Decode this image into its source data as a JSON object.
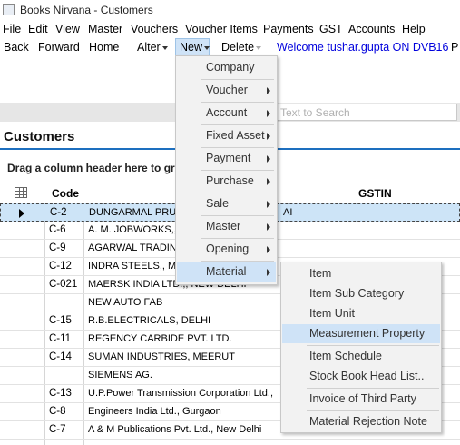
{
  "window": {
    "title": "Books Nirvana - Customers"
  },
  "menubar": [
    "File",
    "Edit",
    "View",
    "Master",
    "Vouchers",
    "Voucher Items",
    "Payments",
    "GST",
    "Accounts",
    "Help"
  ],
  "toolbar": {
    "back": "Back",
    "forward": "Forward",
    "home": "Home",
    "alter": "Alter",
    "new": "New",
    "delete": "Delete",
    "welcome": "Welcome tushar.gupta ON DVB16",
    "overflow": "P"
  },
  "search": {
    "placeholder": "Text to Search"
  },
  "page": {
    "heading": "Customers",
    "group_hint": "Drag a column header here to gr"
  },
  "grid": {
    "columns": {
      "code": "Code",
      "name": "",
      "gstin": "GSTIN"
    },
    "rows": [
      {
        "code": "C-2",
        "name": "DUNGARMAL PRUT",
        "tail": "AI",
        "selected": true
      },
      {
        "code": "C-6",
        "name": "A. M. JOBWORKS,, M"
      },
      {
        "code": "C-9",
        "name": "AGARWAL TRADIN"
      },
      {
        "code": "C-12",
        "name": "INDRA STEELS,, ME"
      },
      {
        "code": "C-021",
        "name": "MAERSK INDIA LTD.,, NEW DELHI"
      },
      {
        "code": "",
        "name": "NEW AUTO FAB"
      },
      {
        "code": "C-15",
        "name": "R.B.ELECTRICALS, DELHI"
      },
      {
        "code": "C-11",
        "name": "REGENCY CARBIDE PVT. LTD."
      },
      {
        "code": "C-14",
        "name": "SUMAN INDUSTRIES, MEERUT"
      },
      {
        "code": "",
        "name": "SIEMENS AG."
      },
      {
        "code": "C-13",
        "name": "U.P.Power Transmission Corporation Ltd.,"
      },
      {
        "code": "C-8",
        "name": "Engineers India Ltd., Gurgaon"
      },
      {
        "code": "C-7",
        "name": "A & M Publications Pvt. Ltd., New Delhi"
      }
    ]
  },
  "new_menu": {
    "items": [
      {
        "label": "Company",
        "submenu": false
      },
      {
        "label": "Voucher",
        "submenu": true
      },
      {
        "label": "Account",
        "submenu": true
      },
      {
        "label": "Fixed Asset",
        "submenu": true
      },
      {
        "label": "Payment",
        "submenu": true
      },
      {
        "label": "Purchase",
        "submenu": true
      },
      {
        "label": "Sale",
        "submenu": true
      },
      {
        "label": "Master",
        "submenu": true
      },
      {
        "label": "Opening",
        "submenu": true
      },
      {
        "label": "Material",
        "submenu": true,
        "highlighted": true
      }
    ]
  },
  "material_menu": {
    "items": [
      {
        "label": "Item"
      },
      {
        "label": "Item Sub Category"
      },
      {
        "label": "Item Unit"
      },
      {
        "label": "Measurement Property",
        "highlighted": true
      },
      {
        "label": "Item Schedule"
      },
      {
        "label": "Stock Book Head List.."
      },
      {
        "label": "Invoice of Third Party"
      },
      {
        "label": "Material Rejection Note"
      }
    ]
  },
  "colors": {
    "accent": "#1d6fbf",
    "highlight": "#cfe3f7",
    "link": "#0000dd"
  }
}
